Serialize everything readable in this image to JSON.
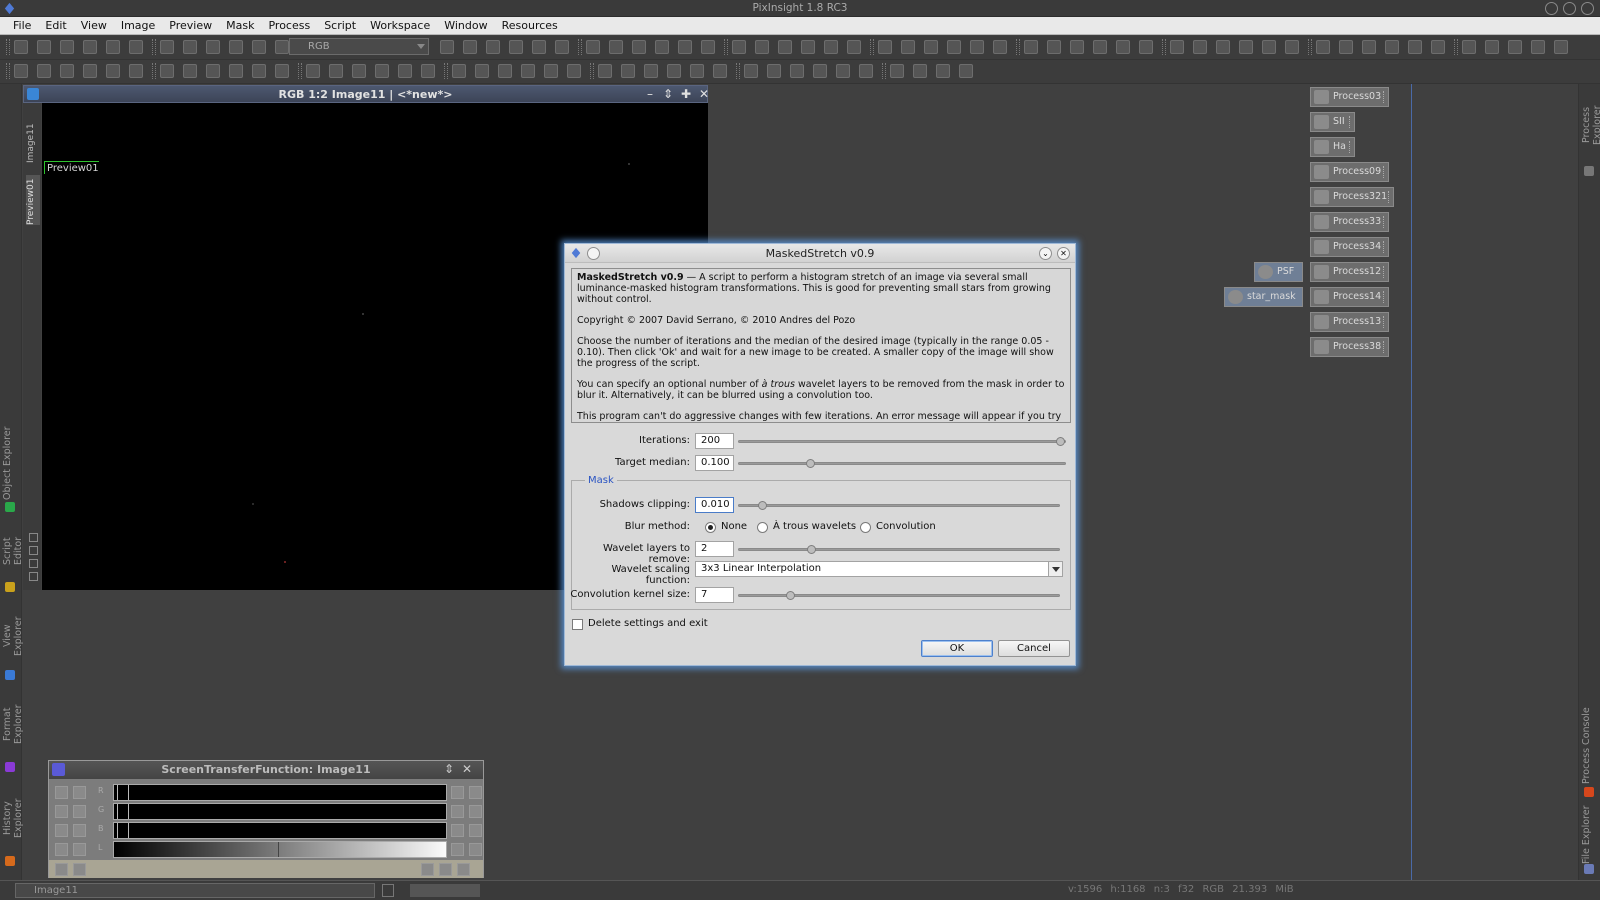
{
  "app": {
    "title": "PixInsight 1.8 RC3"
  },
  "menubar": {
    "items": [
      "File",
      "Edit",
      "View",
      "Image",
      "Preview",
      "Mask",
      "Process",
      "Script",
      "Workspace",
      "Window",
      "Resources"
    ]
  },
  "toolbar": {
    "color_space": "RGB"
  },
  "left_dock": {
    "tabs": [
      "Object Explorer",
      "Script Editor",
      "View Explorer",
      "Format Explorer",
      "History Explorer"
    ]
  },
  "right_dock": {
    "tabs": [
      "Process Explorer",
      "Process Console",
      "File Explorer"
    ]
  },
  "image_window": {
    "title": "RGB 1:2 Image11 | <*new*>",
    "tabs": [
      "Image11",
      "Preview01"
    ],
    "preview_label": "Preview01"
  },
  "process_icons": [
    "Process03",
    "SII",
    "Ha",
    "Process09",
    "Process321",
    "Process33",
    "Process34",
    "Process12",
    "Process14",
    "Process13",
    "Process38"
  ],
  "floating_icons": [
    "PSF",
    "star_mask"
  ],
  "stf_window": {
    "title": "ScreenTransferFunction: Image11",
    "channels": [
      "R",
      "G",
      "B",
      "L"
    ]
  },
  "statusbar": {
    "view": "Image11",
    "info": [
      "v:1596",
      "h:1168",
      "n:3",
      "f32",
      "RGB",
      "21.393 MiB"
    ]
  },
  "dialog": {
    "title": "MaskedStretch v0.9",
    "info": {
      "name": "MaskedStretch v0.9",
      "intro": " — A script to perform a histogram stretch of an image via several small luminance-masked histogram transformations. This is good for preventing small stars from growing without control.",
      "copyright": "Copyright © 2007 David Serrano, © 2010 Andres del Pozo",
      "p2": "Choose the number of iterations and the median of the desired image (typically in the range 0.05 - 0.10). Then click 'Ok' and wait for a new image to be created. A smaller copy of the image will show the progress of the script.",
      "p3a": "You can specify an optional number of ",
      "p3em": "à trous",
      "p3b": " wavelet layers to be removed from the mask in order to blur it. Alternatively, it can be blurred using a convolution too.",
      "p4": "This program can't do aggressive changes with few iterations. An error message will appear if you try to do so."
    },
    "iterations": {
      "label": "Iterations:",
      "value": "200",
      "slider": 1.0
    },
    "target_median": {
      "label": "Target median:",
      "value": "0.100",
      "slider": 0.21
    },
    "mask_group": "Mask",
    "shadows_clipping": {
      "label": "Shadows clipping:",
      "value": "0.010",
      "slider": 0.06
    },
    "blur_method": {
      "label": "Blur method:",
      "options": [
        "None",
        "À trous wavelets",
        "Convolution"
      ],
      "selected": "None"
    },
    "wavelet_layers": {
      "label": "Wavelet layers to remove:",
      "value": "2",
      "slider": 0.22
    },
    "wavelet_scaling": {
      "label": "Wavelet scaling function:",
      "value": "3x3 Linear Interpolation"
    },
    "kernel_size": {
      "label": "Convolution kernel size:",
      "value": "7",
      "slider": 0.15
    },
    "delete_settings": {
      "label": "Delete settings and exit",
      "checked": false
    },
    "ok_label": "OK",
    "cancel_label": "Cancel"
  }
}
